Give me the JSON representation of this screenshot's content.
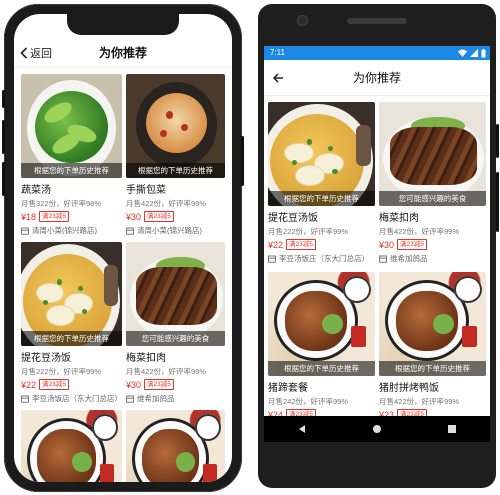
{
  "iphone": {
    "nav": {
      "back_label": "返回",
      "title": "为你推荐"
    },
    "cards": [
      {
        "name": "蔬菜汤",
        "sales": "月售322份，好评率98%",
        "price": "¥18",
        "badge": "满23减5",
        "shop": "清周小菜(锦兴路店)",
        "caption": "根据您的下单历史推荐",
        "food": "veg"
      },
      {
        "name": "手撕包菜",
        "sales": "月售422份，好评率99%",
        "price": "¥30",
        "badge": "满23减5",
        "shop": "清周小菜(锦兴路店)",
        "caption": "根据您的下单历史推荐",
        "food": "bun"
      },
      {
        "name": "提花豆汤饭",
        "sales": "月售222份，好评率99%",
        "price": "¥22",
        "badge": "满23减5",
        "shop": "李豆汤饭店（东大门总店）",
        "caption": "根据您的下单历史推荐",
        "food": "porridge"
      },
      {
        "name": "梅菜扣肉",
        "sales": "月售422份，好评率99%",
        "price": "¥30",
        "badge": "满23减5",
        "shop": "维希加鸽品",
        "caption": "您可能感兴趣的美食",
        "food": "pork"
      },
      {
        "food": "trotter"
      },
      {
        "food": "trotter"
      }
    ]
  },
  "android": {
    "status": {
      "time": "7:11"
    },
    "nav": {
      "title": "为你推荐"
    },
    "cards": [
      {
        "name": "提花豆汤饭",
        "sales": "月售222份，好评率99%",
        "price": "¥22",
        "badge": "满23减5",
        "shop": "李豆汤饭庄（东大门总店）",
        "caption": "根据您的下单历史推荐",
        "food": "porridge"
      },
      {
        "name": "梅菜扣肉",
        "sales": "月售422份，好评率99%",
        "price": "¥30",
        "badge": "满23减5",
        "shop": "维希加鸽品",
        "caption": "您可能感兴趣的美食",
        "food": "pork"
      },
      {
        "name": "猪蹄套餐",
        "sales": "月售242份，好评率99%",
        "price": "¥24",
        "badge": "满23减5",
        "shop": "",
        "caption": "根据您的下单历史推荐",
        "food": "trotter"
      },
      {
        "name": "猪肘拼烤鸭饭",
        "sales": "月售422份，好评率99%",
        "price": "¥23",
        "badge": "满23减5",
        "shop": "",
        "caption": "根据您的下单历史推荐",
        "food": "trotter"
      }
    ]
  },
  "colors": {
    "accent_red": "#e5332a",
    "android_status": "#1e88e5"
  },
  "icons": {
    "back": "chevron-left-icon",
    "arrow_back": "arrow-left-icon",
    "shop": "store-icon"
  }
}
